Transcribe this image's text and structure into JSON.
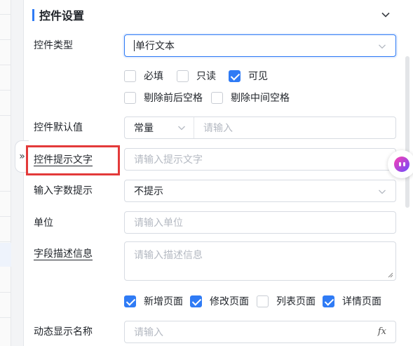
{
  "collapse_handle_glyph": "»",
  "section": {
    "title": "控件设置"
  },
  "fields": {
    "control_type": {
      "label": "控件类型",
      "value": "单行文本"
    },
    "flags": [
      {
        "label": "必填",
        "checked": false
      },
      {
        "label": "只读",
        "checked": false
      },
      {
        "label": "可见",
        "checked": true
      },
      {
        "label": "剔除前后空格",
        "checked": false
      },
      {
        "label": "剔除中间空格",
        "checked": false
      }
    ],
    "default_value": {
      "label": "控件默认值",
      "type_value": "常量",
      "placeholder": "请输入"
    },
    "hint_text": {
      "label": "控件提示文字",
      "placeholder": "请输入提示文字"
    },
    "char_count_hint": {
      "label": "输入字数提示",
      "value": "不提示"
    },
    "unit": {
      "label": "单位",
      "placeholder": "请输入单位"
    },
    "description": {
      "label": "字段描述信息",
      "placeholder": "请输入描述信息"
    },
    "pages": [
      {
        "label": "新增页面",
        "checked": true
      },
      {
        "label": "修改页面",
        "checked": true
      },
      {
        "label": "列表页面",
        "checked": false
      },
      {
        "label": "详情页面",
        "checked": true
      }
    ],
    "dynamic_name": {
      "label": "动态显示名称",
      "placeholder": "请输入",
      "fx_label": "fx"
    }
  },
  "colors": {
    "accent": "#2f7bf5",
    "highlight": "#e33a3a"
  }
}
